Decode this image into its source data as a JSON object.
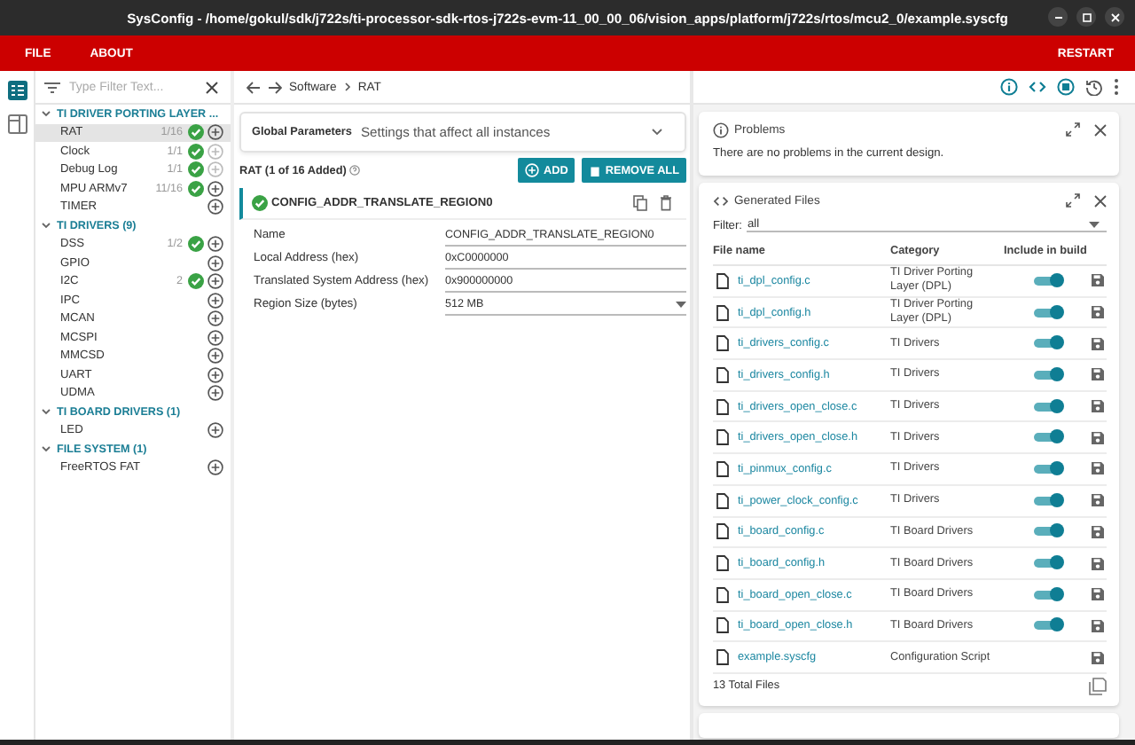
{
  "window": {
    "title": "SysConfig - /home/gokul/sdk/j722s/ti-processor-sdk-rtos-j722s-evm-11_00_00_06/vision_apps/platform/j722s/rtos/mcu2_0/example.syscfg"
  },
  "menu": {
    "items": [
      "FILE",
      "ABOUT"
    ],
    "restart": "RESTART"
  },
  "filter": {
    "placeholder": "Type Filter Text..."
  },
  "breadcrumb": [
    "Software",
    "RAT"
  ],
  "tree": [
    {
      "label": "TI DRIVER PORTING LAYER ...",
      "expanded": true,
      "children": [
        {
          "label": "RAT",
          "count": "1/16",
          "added": true,
          "add_disabled": false,
          "selected": true
        },
        {
          "label": "Clock",
          "count": "1/1",
          "added": true,
          "add_disabled": true,
          "selected": false
        },
        {
          "label": "Debug Log",
          "count": "1/1",
          "added": true,
          "add_disabled": true,
          "selected": false
        },
        {
          "label": "MPU ARMv7",
          "count": "11/16",
          "added": true,
          "add_disabled": false,
          "selected": false
        },
        {
          "label": "TIMER",
          "added": false,
          "add_disabled": false,
          "selected": false
        }
      ]
    },
    {
      "label": "TI DRIVERS (9)",
      "expanded": true,
      "children": [
        {
          "label": "DSS",
          "count": "1/2",
          "added": true,
          "add_disabled": false,
          "selected": false
        },
        {
          "label": "GPIO",
          "added": false,
          "add_disabled": false,
          "selected": false
        },
        {
          "label": "I2C",
          "count": "2",
          "added": true,
          "add_disabled": false,
          "selected": false
        },
        {
          "label": "IPC",
          "added": false,
          "add_disabled": false,
          "selected": false
        },
        {
          "label": "MCAN",
          "added": false,
          "add_disabled": false,
          "selected": false
        },
        {
          "label": "MCSPI",
          "added": false,
          "add_disabled": false,
          "selected": false
        },
        {
          "label": "MMCSD",
          "added": false,
          "add_disabled": false,
          "selected": false
        },
        {
          "label": "UART",
          "added": false,
          "add_disabled": false,
          "selected": false
        },
        {
          "label": "UDMA",
          "added": false,
          "add_disabled": false,
          "selected": false
        }
      ]
    },
    {
      "label": "TI BOARD DRIVERS (1)",
      "expanded": true,
      "children": [
        {
          "label": "LED",
          "added": false,
          "add_disabled": false,
          "selected": false
        }
      ]
    },
    {
      "label": "FILE SYSTEM (1)",
      "expanded": true,
      "children": [
        {
          "label": "FreeRTOS FAT",
          "added": false,
          "add_disabled": false,
          "selected": false
        }
      ]
    }
  ],
  "global_parameters": {
    "title": "Global Parameters",
    "description": "Settings that affect all instances"
  },
  "module": {
    "heading": "RAT (1 of 16 Added)",
    "add": "ADD",
    "remove_all": "REMOVE ALL",
    "instance": "CONFIG_ADDR_TRANSLATE_REGION0",
    "fields": [
      {
        "label": "Name",
        "value": "CONFIG_ADDR_TRANSLATE_REGION0",
        "kind": "text"
      },
      {
        "label": "Local Address (hex)",
        "value": "0xC0000000",
        "kind": "text"
      },
      {
        "label": "Translated System Address (hex)",
        "value": "0x900000000",
        "kind": "text"
      },
      {
        "label": "Region Size (bytes)",
        "value": "512 MB",
        "kind": "select"
      }
    ]
  },
  "problems": {
    "title": "Problems",
    "message": "There are no problems in the current design."
  },
  "generated_files": {
    "title": "Generated Files",
    "filter_label": "Filter:",
    "filter_value": "all",
    "columns": [
      "File name",
      "Category",
      "Include in build"
    ],
    "rows": [
      {
        "name": "ti_dpl_config.c",
        "category": "TI Driver Porting Layer (DPL)",
        "kind": "source",
        "on": true
      },
      {
        "name": "ti_dpl_config.h",
        "category": "TI Driver Porting Layer (DPL)",
        "kind": "source",
        "on": true
      },
      {
        "name": "ti_drivers_config.c",
        "category": "TI Drivers",
        "kind": "source",
        "on": true
      },
      {
        "name": "ti_drivers_config.h",
        "category": "TI Drivers",
        "kind": "source",
        "on": true
      },
      {
        "name": "ti_drivers_open_close.c",
        "category": "TI Drivers",
        "kind": "source",
        "on": true
      },
      {
        "name": "ti_drivers_open_close.h",
        "category": "TI Drivers",
        "kind": "source",
        "on": true
      },
      {
        "name": "ti_pinmux_config.c",
        "category": "TI Drivers",
        "kind": "source",
        "on": true
      },
      {
        "name": "ti_power_clock_config.c",
        "category": "TI Drivers",
        "kind": "source",
        "on": true
      },
      {
        "name": "ti_board_config.c",
        "category": "TI Board Drivers",
        "kind": "source",
        "on": true
      },
      {
        "name": "ti_board_config.h",
        "category": "TI Board Drivers",
        "kind": "source",
        "on": true
      },
      {
        "name": "ti_board_open_close.c",
        "category": "TI Board Drivers",
        "kind": "source",
        "on": true
      },
      {
        "name": "ti_board_open_close.h",
        "category": "TI Board Drivers",
        "kind": "source",
        "on": true
      },
      {
        "name": "example.syscfg",
        "category": "Configuration Script",
        "kind": "script"
      }
    ],
    "total": "13 Total Files"
  }
}
